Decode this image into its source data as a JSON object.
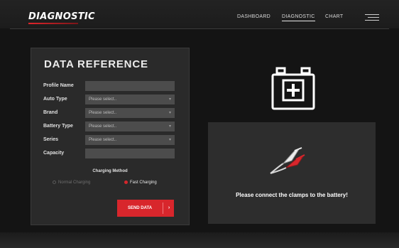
{
  "header": {
    "logo": "DIAGNOSTIC",
    "nav": [
      {
        "label": "DASHBOARD",
        "active": false
      },
      {
        "label": "DIAGNOSTIC",
        "active": true
      },
      {
        "label": "CHART",
        "active": false
      }
    ],
    "menu_icon": "hamburger-icon"
  },
  "form": {
    "title": "DATA REFERENCE",
    "fields": [
      {
        "label": "Profile Name",
        "value": "",
        "placeholder": ""
      },
      {
        "label": "Auto Type",
        "value": "Please select..",
        "dropdown": true
      },
      {
        "label": "Brand",
        "value": "Please select..",
        "dropdown": true
      },
      {
        "label": "Battery Type",
        "value": "Please select..",
        "dropdown": true
      },
      {
        "label": "Series",
        "value": "Please select..",
        "dropdown": true
      },
      {
        "label": "Capacity",
        "value": "",
        "placeholder": ""
      }
    ],
    "charging_method_label": "Charging Method",
    "options": [
      {
        "label": "Normal Charging",
        "selected": false
      },
      {
        "label": "Fast Charging",
        "selected": true
      }
    ],
    "send_button": "SEND DATA",
    "send_arrow": "›"
  },
  "status": {
    "battery_icon": "battery-plus-icon",
    "clamps_icon": "jumper-clamps-icon",
    "message": "Please connect the clamps to the battery!"
  },
  "colors": {
    "accent": "#d8262c",
    "background": "#141414",
    "panel": "#2a2a2a",
    "field": "#4c4c4c"
  }
}
